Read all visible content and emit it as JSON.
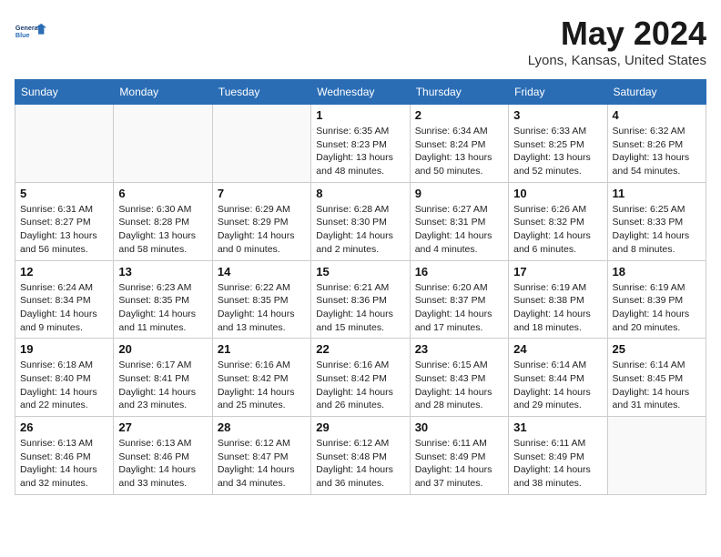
{
  "header": {
    "logo_line1": "General",
    "logo_line2": "Blue",
    "month_year": "May 2024",
    "location": "Lyons, Kansas, United States"
  },
  "weekdays": [
    "Sunday",
    "Monday",
    "Tuesday",
    "Wednesday",
    "Thursday",
    "Friday",
    "Saturday"
  ],
  "weeks": [
    [
      {
        "day": "",
        "info": ""
      },
      {
        "day": "",
        "info": ""
      },
      {
        "day": "",
        "info": ""
      },
      {
        "day": "1",
        "info": "Sunrise: 6:35 AM\nSunset: 8:23 PM\nDaylight: 13 hours\nand 48 minutes."
      },
      {
        "day": "2",
        "info": "Sunrise: 6:34 AM\nSunset: 8:24 PM\nDaylight: 13 hours\nand 50 minutes."
      },
      {
        "day": "3",
        "info": "Sunrise: 6:33 AM\nSunset: 8:25 PM\nDaylight: 13 hours\nand 52 minutes."
      },
      {
        "day": "4",
        "info": "Sunrise: 6:32 AM\nSunset: 8:26 PM\nDaylight: 13 hours\nand 54 minutes."
      }
    ],
    [
      {
        "day": "5",
        "info": "Sunrise: 6:31 AM\nSunset: 8:27 PM\nDaylight: 13 hours\nand 56 minutes."
      },
      {
        "day": "6",
        "info": "Sunrise: 6:30 AM\nSunset: 8:28 PM\nDaylight: 13 hours\nand 58 minutes."
      },
      {
        "day": "7",
        "info": "Sunrise: 6:29 AM\nSunset: 8:29 PM\nDaylight: 14 hours\nand 0 minutes."
      },
      {
        "day": "8",
        "info": "Sunrise: 6:28 AM\nSunset: 8:30 PM\nDaylight: 14 hours\nand 2 minutes."
      },
      {
        "day": "9",
        "info": "Sunrise: 6:27 AM\nSunset: 8:31 PM\nDaylight: 14 hours\nand 4 minutes."
      },
      {
        "day": "10",
        "info": "Sunrise: 6:26 AM\nSunset: 8:32 PM\nDaylight: 14 hours\nand 6 minutes."
      },
      {
        "day": "11",
        "info": "Sunrise: 6:25 AM\nSunset: 8:33 PM\nDaylight: 14 hours\nand 8 minutes."
      }
    ],
    [
      {
        "day": "12",
        "info": "Sunrise: 6:24 AM\nSunset: 8:34 PM\nDaylight: 14 hours\nand 9 minutes."
      },
      {
        "day": "13",
        "info": "Sunrise: 6:23 AM\nSunset: 8:35 PM\nDaylight: 14 hours\nand 11 minutes."
      },
      {
        "day": "14",
        "info": "Sunrise: 6:22 AM\nSunset: 8:35 PM\nDaylight: 14 hours\nand 13 minutes."
      },
      {
        "day": "15",
        "info": "Sunrise: 6:21 AM\nSunset: 8:36 PM\nDaylight: 14 hours\nand 15 minutes."
      },
      {
        "day": "16",
        "info": "Sunrise: 6:20 AM\nSunset: 8:37 PM\nDaylight: 14 hours\nand 17 minutes."
      },
      {
        "day": "17",
        "info": "Sunrise: 6:19 AM\nSunset: 8:38 PM\nDaylight: 14 hours\nand 18 minutes."
      },
      {
        "day": "18",
        "info": "Sunrise: 6:19 AM\nSunset: 8:39 PM\nDaylight: 14 hours\nand 20 minutes."
      }
    ],
    [
      {
        "day": "19",
        "info": "Sunrise: 6:18 AM\nSunset: 8:40 PM\nDaylight: 14 hours\nand 22 minutes."
      },
      {
        "day": "20",
        "info": "Sunrise: 6:17 AM\nSunset: 8:41 PM\nDaylight: 14 hours\nand 23 minutes."
      },
      {
        "day": "21",
        "info": "Sunrise: 6:16 AM\nSunset: 8:42 PM\nDaylight: 14 hours\nand 25 minutes."
      },
      {
        "day": "22",
        "info": "Sunrise: 6:16 AM\nSunset: 8:42 PM\nDaylight: 14 hours\nand 26 minutes."
      },
      {
        "day": "23",
        "info": "Sunrise: 6:15 AM\nSunset: 8:43 PM\nDaylight: 14 hours\nand 28 minutes."
      },
      {
        "day": "24",
        "info": "Sunrise: 6:14 AM\nSunset: 8:44 PM\nDaylight: 14 hours\nand 29 minutes."
      },
      {
        "day": "25",
        "info": "Sunrise: 6:14 AM\nSunset: 8:45 PM\nDaylight: 14 hours\nand 31 minutes."
      }
    ],
    [
      {
        "day": "26",
        "info": "Sunrise: 6:13 AM\nSunset: 8:46 PM\nDaylight: 14 hours\nand 32 minutes."
      },
      {
        "day": "27",
        "info": "Sunrise: 6:13 AM\nSunset: 8:46 PM\nDaylight: 14 hours\nand 33 minutes."
      },
      {
        "day": "28",
        "info": "Sunrise: 6:12 AM\nSunset: 8:47 PM\nDaylight: 14 hours\nand 34 minutes."
      },
      {
        "day": "29",
        "info": "Sunrise: 6:12 AM\nSunset: 8:48 PM\nDaylight: 14 hours\nand 36 minutes."
      },
      {
        "day": "30",
        "info": "Sunrise: 6:11 AM\nSunset: 8:49 PM\nDaylight: 14 hours\nand 37 minutes."
      },
      {
        "day": "31",
        "info": "Sunrise: 6:11 AM\nSunset: 8:49 PM\nDaylight: 14 hours\nand 38 minutes."
      },
      {
        "day": "",
        "info": ""
      }
    ]
  ]
}
